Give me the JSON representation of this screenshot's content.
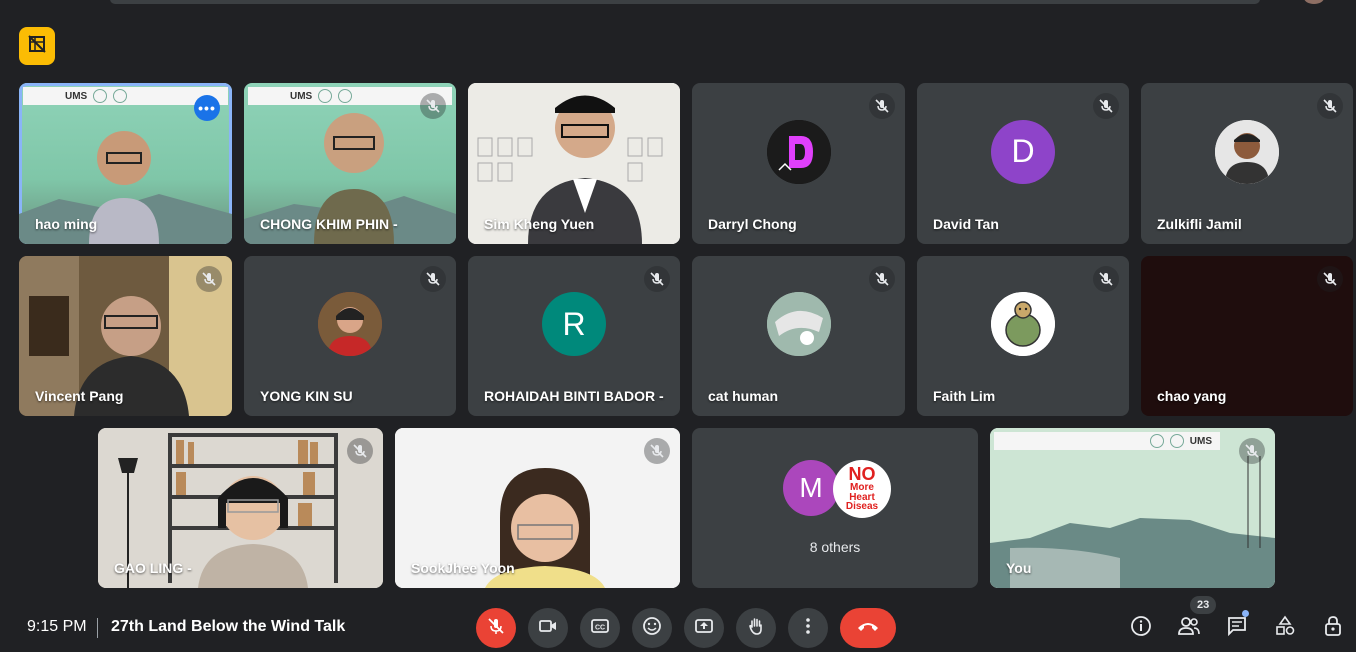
{
  "meeting": {
    "time": "9:15 PM",
    "title": "27th Land Below the Wind Talk"
  },
  "participants_count": "23",
  "tiles": [
    {
      "name": "hao ming",
      "kind": "video",
      "speaking": true
    },
    {
      "name": "CHONG KHIM PHIN -",
      "kind": "video",
      "muted": true
    },
    {
      "name": "Sim Kheng Yuen",
      "kind": "video"
    },
    {
      "name": "Darryl Chong",
      "kind": "avatar",
      "initial": "D",
      "color": "#111111"
    },
    {
      "name": "David Tan",
      "kind": "avatar",
      "initial": "D",
      "color": "#8e44c9"
    },
    {
      "name": "Zulkifli Jamil",
      "kind": "photo"
    },
    {
      "name": "Vincent Pang",
      "kind": "video"
    },
    {
      "name": "YONG KIN SU",
      "kind": "photo"
    },
    {
      "name": "ROHAIDAH BINTI BADOR -",
      "kind": "avatar",
      "initial": "R",
      "color": "#00897b"
    },
    {
      "name": "cat human",
      "kind": "photo"
    },
    {
      "name": "Faith Lim",
      "kind": "photo"
    },
    {
      "name": "chao yang",
      "kind": "blank"
    },
    {
      "name": "GAO LING -",
      "kind": "video"
    },
    {
      "name": "SookJhee Yoon",
      "kind": "video"
    },
    {
      "name": "8 others",
      "kind": "group",
      "initial": "M",
      "color": "#ab47bc",
      "badge_lines": [
        "NO",
        "More",
        "Heart",
        "Diseas"
      ]
    },
    {
      "name": "You",
      "kind": "video"
    }
  ],
  "banner": {
    "ums": "UMS"
  },
  "colors": {
    "accent": "#8ab4f8",
    "end_call": "#ea4335",
    "highlight": "#fbbc04"
  },
  "controls": [
    "mic-off-icon",
    "camera-icon",
    "captions-icon",
    "emoji-icon",
    "present-icon",
    "raise-hand-icon",
    "more-options-icon",
    "end-call-icon"
  ],
  "right_controls": [
    "info-icon",
    "people-icon",
    "chat-icon",
    "activities-icon",
    "host-controls-icon"
  ]
}
